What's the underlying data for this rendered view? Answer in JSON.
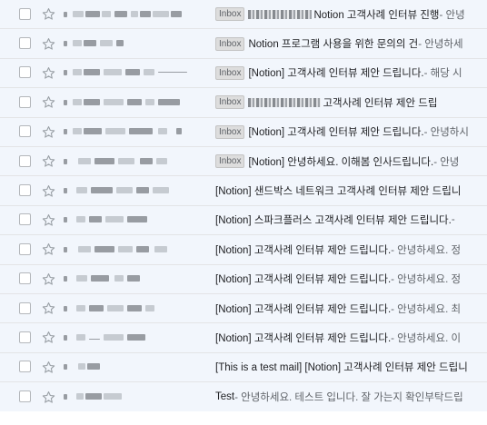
{
  "rows": [
    {
      "badge": "Inbox",
      "subject": "Notion 고객사례 인터뷰 진행",
      "snippet": " - 안녕"
    },
    {
      "badge": "Inbox",
      "subject": "Notion 프로그램 사용을 위한 문의의 건",
      "snippet": " - 안녕하세"
    },
    {
      "badge": "Inbox",
      "subject": "[Notion] 고객사례 인터뷰 제안 드립니다.",
      "snippet": " - 해당 시"
    },
    {
      "badge": "Inbox",
      "subject": "고객사례 인터뷰 제안 드립",
      "snippet": ""
    },
    {
      "badge": "Inbox",
      "subject": "[Notion] 고객사례 인터뷰 제안 드립니다.",
      "snippet": " - 안녕하시"
    },
    {
      "badge": "Inbox",
      "subject": "[Notion] 안녕하세요. 이해봄 인사드립니다.",
      "snippet": " - 안녕"
    },
    {
      "badge": "",
      "subject": "[Notion] 샌드박스 네트워크 고객사례 인터뷰 제안 드립니",
      "snippet": ""
    },
    {
      "badge": "",
      "subject": "[Notion] 스파크플러스 고객사례 인터뷰 제안 드립니다.",
      "snippet": " - "
    },
    {
      "badge": "",
      "subject": "[Notion] 고객사례 인터뷰 제안 드립니다.",
      "snippet": " - 안녕하세요. 정"
    },
    {
      "badge": "",
      "subject": "[Notion] 고객사례 인터뷰 제안 드립니다.",
      "snippet": " - 안녕하세요. 정"
    },
    {
      "badge": "",
      "subject": "[Notion] 고객사례 인터뷰 제안 드립니다.",
      "snippet": " - 안녕하세요. 최"
    },
    {
      "badge": "",
      "subject": "[Notion] 고객사례 인터뷰 제안 드립니다.",
      "snippet": " - 안녕하세요. 이"
    },
    {
      "badge": "",
      "subject": "[This is a test mail] [Notion] 고객사례 인터뷰 제안 드립니",
      "snippet": ""
    },
    {
      "badge": "",
      "subject": "Test",
      "snippet": " - 안녕하세요. 테스트 입니다. 잘 가는지 확인부탁드립"
    }
  ],
  "icons": {
    "checkbox": "checkbox-icon",
    "star": "star-outline-icon"
  }
}
